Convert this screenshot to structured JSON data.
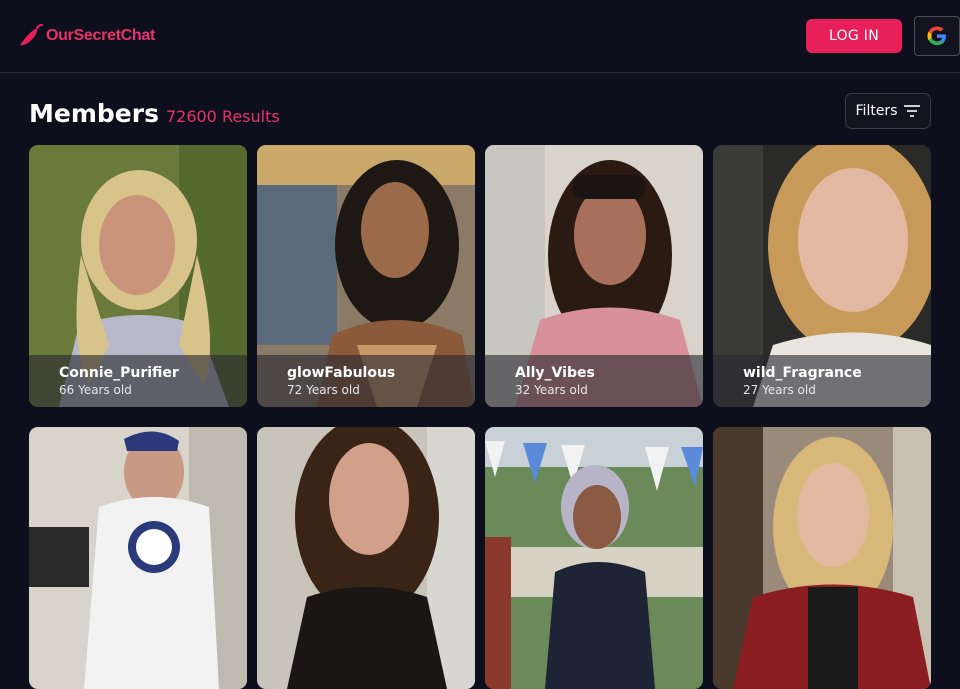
{
  "header": {
    "logo_text": "OurSecretChat",
    "login_label": "LOG IN",
    "google_icon": "google-icon",
    "accent_color": "#e8205a"
  },
  "main": {
    "title": "Members",
    "results": "72600 Results",
    "filters_label": "Filters"
  },
  "members": [
    {
      "name": "Connie_Purifier",
      "age": "66 Years old"
    },
    {
      "name": "glowFabulous",
      "age": "72 Years old"
    },
    {
      "name": "Ally_Vibes",
      "age": "32 Years old"
    },
    {
      "name": "wild_Fragrance",
      "age": "27 Years old"
    },
    {
      "name": "",
      "age": ""
    },
    {
      "name": "",
      "age": ""
    },
    {
      "name": "",
      "age": ""
    },
    {
      "name": "",
      "age": ""
    }
  ]
}
